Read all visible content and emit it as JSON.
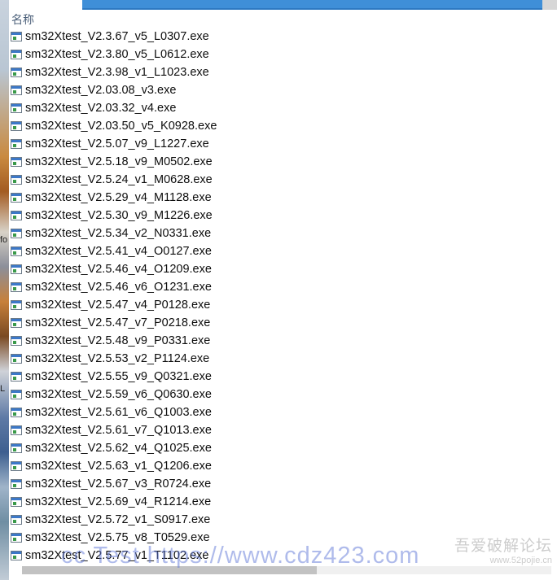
{
  "desktop": {
    "glyphs": [
      "fo",
      "L"
    ]
  },
  "column_header": "名称",
  "files": [
    "sm32Xtest_V2.3.67_v5_L0307.exe",
    "sm32Xtest_V2.3.80_v5_L0612.exe",
    "sm32Xtest_V2.3.98_v1_L1023.exe",
    "sm32Xtest_V2.03.08_v3.exe",
    "sm32Xtest_V2.03.32_v4.exe",
    "sm32Xtest_V2.03.50_v5_K0928.exe",
    "sm32Xtest_V2.5.07_v9_L1227.exe",
    "sm32Xtest_V2.5.18_v9_M0502.exe",
    "sm32Xtest_V2.5.24_v1_M0628.exe",
    "sm32Xtest_V2.5.29_v4_M1128.exe",
    "sm32Xtest_V2.5.30_v9_M1226.exe",
    "sm32Xtest_V2.5.34_v2_N0331.exe",
    "sm32Xtest_V2.5.41_v4_O0127.exe",
    "sm32Xtest_V2.5.46_v4_O1209.exe",
    "sm32Xtest_V2.5.46_v6_O1231.exe",
    "sm32Xtest_V2.5.47_v4_P0128.exe",
    "sm32Xtest_V2.5.47_v7_P0218.exe",
    "sm32Xtest_V2.5.48_v9_P0331.exe",
    "sm32Xtest_V2.5.53_v2_P1124.exe",
    "sm32Xtest_V2.5.55_v9_Q0321.exe",
    "sm32Xtest_V2.5.59_v6_Q0630.exe",
    "sm32Xtest_V2.5.61_v6_Q1003.exe",
    "sm32Xtest_V2.5.61_v7_Q1013.exe",
    "sm32Xtest_V2.5.62_v4_Q1025.exe",
    "sm32Xtest_V2.5.63_v1_Q1206.exe",
    "sm32Xtest_V2.5.67_v3_R0724.exe",
    "sm32Xtest_V2.5.69_v4_R1214.exe",
    "sm32Xtest_V2.5.72_v1_S0917.exe",
    "sm32Xtest_V2.5.75_v8_T0529.exe",
    "sm32Xtest_V2.5.77_v1_T1102.exe"
  ],
  "file_icon": "exe-file-icon",
  "watermarks": {
    "url": "cc Test https://www.cdz423.com",
    "site_cn": "吾爱破解论坛",
    "site_domain": "www.52pojie.cn"
  },
  "colors": {
    "title_bar": "#3f8fd8",
    "header_text": "#4c607a",
    "file_text": "#0d0d0d",
    "watermark_url": "#5f78d7"
  }
}
